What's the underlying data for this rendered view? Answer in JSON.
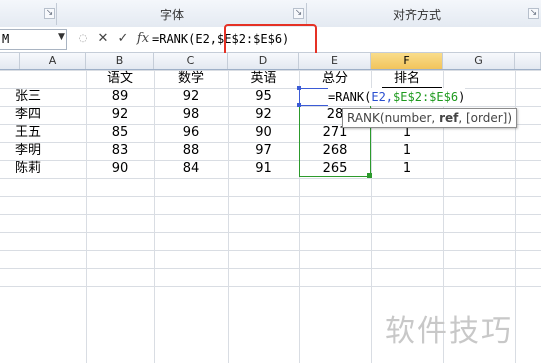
{
  "ribbon": {
    "font_group": "字体",
    "align_group": "对齐方式",
    "launcher_glyph": "↘"
  },
  "formula_bar": {
    "name_box": "M",
    "cancel_glyph": "✕",
    "enter_glyph": "✓",
    "fx_label": "fx",
    "formula_text": "=RANK(E2,$E$2:$E$6)"
  },
  "columns": [
    "A",
    "B",
    "C",
    "D",
    "E",
    "F",
    "G"
  ],
  "active_column": "F",
  "sheet": {
    "headers": [
      "语文",
      "数学",
      "英语",
      "总分",
      "排名"
    ],
    "rows": [
      {
        "name": "张三",
        "chinese": "89",
        "math": "92",
        "english": "95",
        "total": "",
        "rank": ""
      },
      {
        "name": "李四",
        "chinese": "92",
        "math": "98",
        "english": "92",
        "total": "28",
        "rank": ""
      },
      {
        "name": "王五",
        "chinese": "85",
        "math": "96",
        "english": "90",
        "total": "271",
        "rank": "1"
      },
      {
        "name": "李明",
        "chinese": "83",
        "math": "88",
        "english": "97",
        "total": "268",
        "rank": "1"
      },
      {
        "name": "陈莉",
        "chinese": "90",
        "math": "84",
        "english": "91",
        "total": "265",
        "rank": "1"
      }
    ]
  },
  "edit": {
    "prefix": "=RANK(",
    "ref1": "E2,",
    "ref2": "$E$2:$E$6",
    "suffix": ")"
  },
  "tooltip": {
    "fn": "RANK(number, ",
    "bold_arg": "ref",
    "rest": ", [order])"
  },
  "watermark": "软件技巧"
}
